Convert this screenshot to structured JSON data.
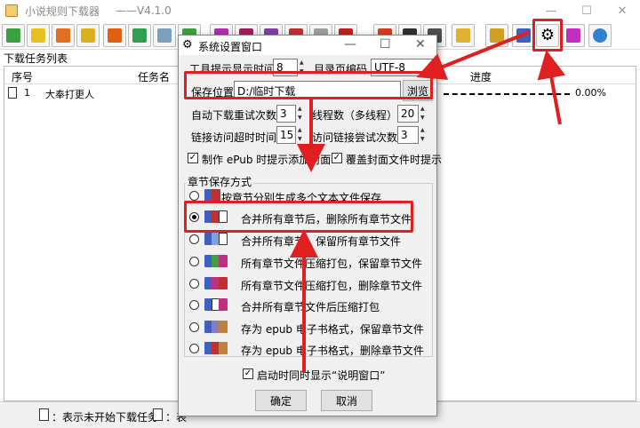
{
  "app": {
    "title": "小说规则下载器",
    "version": "——V4.1.0"
  },
  "window_controls": {
    "minimize": "—",
    "maximize": "☐",
    "close": "✕"
  },
  "toolbar": {
    "icons": [
      "download-icon",
      "book-icon",
      "refresh-icon",
      "notes-icon",
      "link-icon",
      "check-icon",
      "copy-icon",
      "export-icon",
      "play-icon",
      "stop-icon",
      "pause-icon",
      "delete-icon",
      "list-icon",
      "close-icon",
      "flag-icon",
      "clock-icon",
      "calendar-icon",
      "folder-icon",
      "doc-icon",
      "notebook-icon",
      "settings-gear-icon",
      "help-book-icon",
      "chat-icon"
    ]
  },
  "task_panel": {
    "label": "下载任务列表",
    "columns": {
      "no": "序号",
      "task": "任务名",
      "progress": "进度"
    },
    "rows": [
      {
        "no": "1",
        "name": "大奉打更人",
        "progress": "0.00%"
      }
    ]
  },
  "status": {
    "text1": "：表示未开始下载任务",
    "text2": "：表"
  },
  "dialog": {
    "title": "系统设置窗口",
    "tooltip_label": "工具提示显示时间",
    "tooltip_value": "8",
    "encoding_label": "目录页编码",
    "encoding_value": "UTF-8",
    "save_label": "保存位置",
    "save_value": "D:/临时下载",
    "browse": "浏览",
    "retry_label": "自动下载重试次数",
    "retry_value": "3",
    "threads_label": "线程数（多线程）",
    "threads_value": "20",
    "timeout_label": "链接访问超时时间",
    "timeout_value": "15",
    "link_retry_label": "访问链接尝试次数",
    "link_retry_value": "3",
    "epub_cover_label": "制作 ePub 时提示添加封面",
    "overwrite_cover_label": "覆盖封面文件时提示",
    "group_label": "章节保存方式",
    "options": [
      "按章节分别生成多个文本文件保存",
      "合并所有章节后，删除所有章节文件",
      "合并所有章节，保留所有章节文件",
      "所有章节文件压缩打包，保留章节文件",
      "所有章节文件压缩打包，删除章节文件",
      "合并所有章节文件后压缩打包",
      "存为 epub 电子书格式，保留章节文件",
      "存为 epub 电子书格式，删除章节文件"
    ],
    "selected_option_index": 1,
    "startup_label": "启动时同时显示“说明窗口”",
    "ok": "确定",
    "cancel": "取消"
  },
  "colors": {
    "highlight": "#e02020"
  }
}
